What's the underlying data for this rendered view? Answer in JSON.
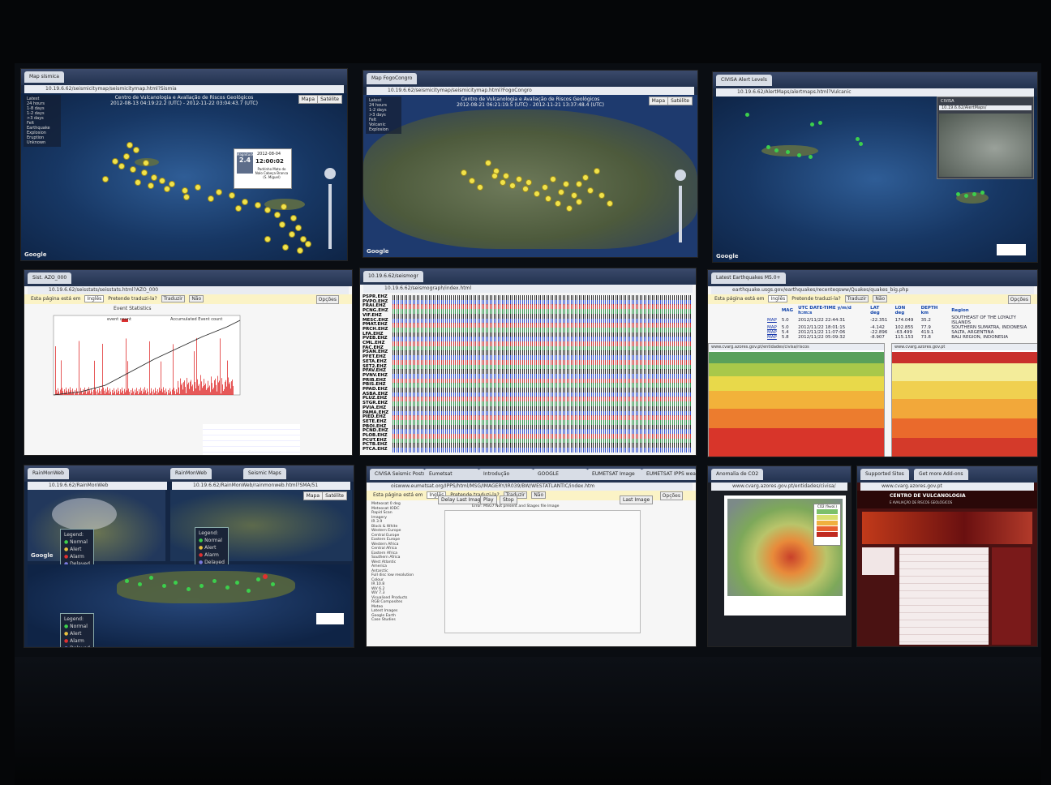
{
  "panels": {
    "p1": {
      "tab": "Map sísmica",
      "url": "10.19.6.62/seismicitymap/seismicitymap.html?Sismia",
      "title": "Centro de Vulcanologia e Avaliação de Riscos Geológicos",
      "subtitle": "2012-08-13 04:19:22.2 (UTC) - 2012-11-22 03:04:43.7 (UTC)",
      "map_btn": "Mapa",
      "sat_btn": "Satélite",
      "legend": [
        "Latest",
        "24 hours",
        "1-8 days",
        "1-2 days",
        ">3 days",
        "Felt",
        "Earthquake",
        "Explosion",
        "Eruption",
        "Unknown"
      ],
      "popup_label": "Magnitude",
      "popup_mag": "2.4",
      "popup_date": "2012-08-04",
      "popup_time": "12:00:02",
      "popup_place": "Padrinho Mato do Nalo Cabeça Branca (S. Miguel)",
      "google": "Google"
    },
    "p2": {
      "tab": "Map FogoCongro",
      "url": "10.19.6.62/seismicitymap/seismicitymap.html?FogoCongro",
      "title": "Centro de Vulcanologia e Avaliação de Riscos Geológicos",
      "subtitle": "2012-08-21 06:21:19.5 (UTC) - 2012-11-21 13:37:48.4 (UTC)",
      "map_btn": "Mapa",
      "sat_btn": "Satélite",
      "legend": [
        "Latest",
        "24 hours",
        "1-2 days",
        ">3 days",
        "Felt",
        "Volcanic",
        "Explosion"
      ],
      "google": "Google"
    },
    "p3": {
      "tab": "CIVISA Alert Levels",
      "url": "10.19.6.62/AlertMaps/alertmaps.html?Vulcanic",
      "inset_tab": "CIVISA",
      "inset_url": "10.19.6.62/AlertMaps/",
      "google": "Google"
    },
    "p4": {
      "tab": "Sist. AZO_000",
      "url": "10.19.6.62/seisstats/seisstats.html?AZO_000",
      "translate_text": "Esta página está em",
      "translate_lang": "Inglês",
      "translate_q": "Pretende traduzi-la?",
      "translate_yes": "Traduzir",
      "translate_no": "Não",
      "options": "Opções",
      "chart_title": "Event Statistics",
      "legend_count": "event count",
      "legend_accum": "Accumulated Event count"
    },
    "p5": {
      "tab": "10.19.6.62/seismogr",
      "url": "10.19.6.62/seismograph/index.html",
      "stations": [
        "PSPR.EHZ",
        "PVPO.EHZ",
        "FRAI.EHZ",
        "PCNG.EHZ",
        "VIF.EHZ",
        "MESC.EHZ",
        "PMAT.EHZ",
        "PRCH.EHZ",
        "LFA.EHZ",
        "PVEB.EHZ",
        "CML.EHZ",
        "FAC.EHZ",
        "PSAN.EHZ",
        "PFET.EHZ",
        "SETA.EHZ",
        "SET2.EHZ",
        "PFAV.EHZ",
        "PVNV.EHZ",
        "PRIB.EHZ",
        "PBIS.EHZ",
        "PPAD.EHZ",
        "ASBA.EHZ",
        "PLUZ.EHZ",
        "STGR.EHZ",
        "PVIA.EHZ",
        "PAMA.EHZ",
        "PIED.EHZ",
        "SETE.EHZ",
        "PBOI.EHZ",
        "PCND.EHZ",
        "PLOB.EHZ",
        "PCUT.EHZ",
        "PCTB.EHZ",
        "PTCA.EHZ"
      ]
    },
    "p6": {
      "tab": "Latest Earthquakes M5.0+",
      "url": "earthquake.usgs.gov/earthquakes/recenteqsww/Quakes/quakes_big.php",
      "translate_text": "Esta página está em",
      "translate_lang": "Inglês",
      "translate_q": "Pretende traduzi-la?",
      "translate_yes": "Traduzir",
      "translate_no": "Não",
      "options": "Opções",
      "headers": [
        "MAG",
        "UTC DATE-TIME y/m/d h:m:s",
        "LAT deg",
        "LON deg",
        "DEPTH km",
        "Region"
      ],
      "rows": [
        {
          "map": "MAP",
          "mag": "5.0",
          "dt": "2012/11/22 22:44:31",
          "lat": "-22.351",
          "lon": "174.049",
          "depth": "35.2",
          "region": "SOUTHEAST OF THE LOYALTY ISLANDS"
        },
        {
          "map": "MAP",
          "mag": "5.0",
          "dt": "2012/11/22 18:01:15",
          "lat": "-4.142",
          "lon": "102.855",
          "depth": "77.9",
          "region": "SOUTHERN SUMATRA, INDONESIA"
        },
        {
          "map": "MAP",
          "mag": "5.4",
          "dt": "2012/11/22 11:07:06",
          "lat": "-22.896",
          "lon": "-63.499",
          "depth": "419.1",
          "region": "SALTA, ARGENTINA"
        },
        {
          "map": "MAP",
          "mag": "5.8",
          "dt": "2012/11/22 05:09:32",
          "lat": "-8.907",
          "lon": "115.153",
          "depth": "73.8",
          "region": "BALI REGION, INDONESIA"
        }
      ],
      "sub_url_left": "www.cvarg.azores.gov.pt/entidades/civisa/riscos",
      "sub_url_right": "www.cvarg.azores.gov.pt"
    },
    "p7": {
      "tab": "RainMonWeb",
      "tab2": "RainMonWeb",
      "tab3": "Seismic Maps",
      "url": "10.19.6.62/RainMonWeb",
      "url2": "10.19.6.62/RainMonWeb/rainmonweb.html?SMA/51",
      "map_btn": "Mapa",
      "sat_btn": "Satélite",
      "legend_title": "Legend:",
      "legend": [
        "Normal",
        "Alert",
        "Alarm",
        "Delayed"
      ],
      "google": "Google"
    },
    "p8": {
      "tabs": [
        "CIVISA Seismic Posts",
        "Eumetsat",
        "Introdução",
        "GOOGLE",
        "EUMETSAT Image",
        "EUMETSAT IPPS weath"
      ],
      "url": "oiswww.eumetsat.org/IPPS/html/MSG/IMAGERY/IR039/BW/WESTATLANTIC/index.htm",
      "translate_text": "Esta página está em",
      "translate_lang": "Inglês",
      "translate_q": "Pretende traduzi-la?",
      "translate_yes": "Traduzir",
      "translate_no": "Não",
      "options": "Opções",
      "tree": [
        "Meteosat 0 deg",
        "Meteosat IODC",
        "Rapid Scan",
        "Imagery",
        "IR 3.9",
        "Black & White",
        "Western Europe",
        "Central Europe",
        "Eastern Europe",
        "Western Africa",
        "Central Africa",
        "Eastern Africa",
        "Southern Africa",
        "West Atlantic",
        "America",
        "Antarctic",
        "Full disc low resolution",
        "Colour",
        "IR 10.8",
        "WV 6.2",
        "WV 7.3",
        "Visualised Products",
        "RGB Composites",
        "Meteo",
        "Latest Images",
        "Google Earth",
        "Case Studies"
      ],
      "btn_delay": "Delay Last Image",
      "btn_play": "Play",
      "btn_stop": "Stop",
      "btn_last": "Last Image",
      "msg": "Error: MSG7 Not present and Stages file Image"
    },
    "p9": {
      "tab": "Anomalia de CO2",
      "url": "www.cvarg.azores.gov.pt/entidades/civisa/",
      "legend_title": "CO2 (%vol.)"
    },
    "p10": {
      "tab": "Supported Sites",
      "tab2": "Get more Add-ons",
      "url": "www.cvarg.azores.gov.pt",
      "site_title": "CENTRO DE VULCANOLOGIA",
      "site_sub": "E AVALIAÇÃO DE RISCOS GEOLÓGICOS"
    }
  }
}
